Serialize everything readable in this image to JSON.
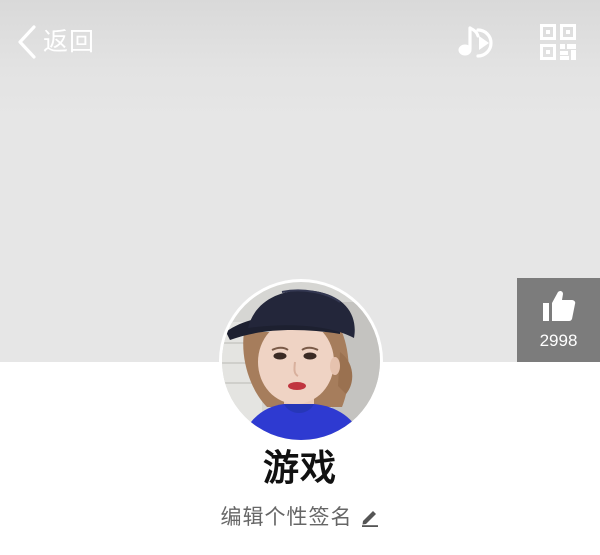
{
  "header": {
    "back_label": "返回",
    "back_icon": "chevron-left-icon",
    "music_icon": "music-play-icon",
    "qr_icon": "qr-code-icon"
  },
  "like": {
    "icon": "thumbs-up-icon",
    "count": "2998"
  },
  "profile": {
    "avatar": "avatar-photo",
    "name": "游戏",
    "signature": "编辑个性签名",
    "signature_icon": "pencil-icon"
  },
  "colors": {
    "cover": "#e6e6e6",
    "like_badge": "#7c7c7c",
    "name_text": "#111111",
    "signature_text": "#666666"
  }
}
